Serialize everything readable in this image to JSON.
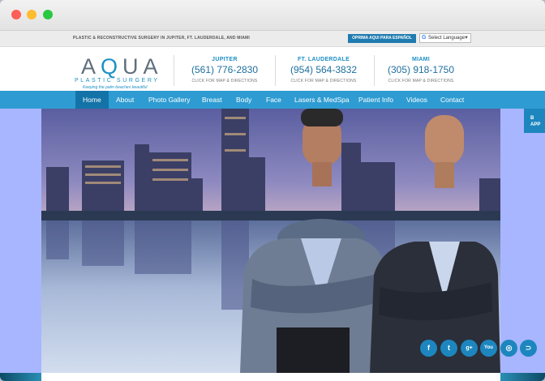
{
  "topbar": {
    "tagline": "PLASTIC & RECONSTRUCTIVE SURGERY IN JUPITER, FT. LAUDERDALE, AND MIAMI",
    "espanol_button": "OPRIMA AQUI PARA ESPAÑOL",
    "language_select": "Select Language"
  },
  "logo": {
    "word_a": "A",
    "word_q": "Q",
    "word_ua": "UA",
    "sub": "PLASTIC SURGERY",
    "slogan": "Keeping the palm beaches beautiful"
  },
  "locations": [
    {
      "city": "JUPITER",
      "phone": "(561) 776-2830",
      "directions": "CLICK FOR MAP & DIRECTIONS"
    },
    {
      "city": "FT. LAUDERDALE",
      "phone": "(954) 564-3832",
      "directions": "CLICK FOR MAP & DIRECTIONS"
    },
    {
      "city": "MIAMI",
      "phone": "(305) 918-1750",
      "directions": "CLICK FOR MAP & DIRECTIONS"
    }
  ],
  "nav": {
    "items": [
      "Home",
      "About",
      "Photo Gallery",
      "Breast",
      "Body",
      "Face",
      "Lasers & MedSpa",
      "Patient Info",
      "Videos",
      "Contact"
    ],
    "active": "Home"
  },
  "side_tab": {
    "line1": "B",
    "line2": "APP"
  },
  "social": [
    {
      "icon": "facebook-icon",
      "glyph": "f"
    },
    {
      "icon": "twitter-icon",
      "glyph": "t"
    },
    {
      "icon": "google-plus-icon",
      "glyph": "g+"
    },
    {
      "icon": "youtube-icon",
      "glyph": "You"
    },
    {
      "icon": "instagram-icon",
      "glyph": "◎"
    },
    {
      "icon": "rss-icon",
      "glyph": "⊃"
    }
  ],
  "colors": {
    "brand_blue": "#2e9cd2",
    "active_nav": "#1373a8",
    "hero_background": "#a8b6ff"
  }
}
